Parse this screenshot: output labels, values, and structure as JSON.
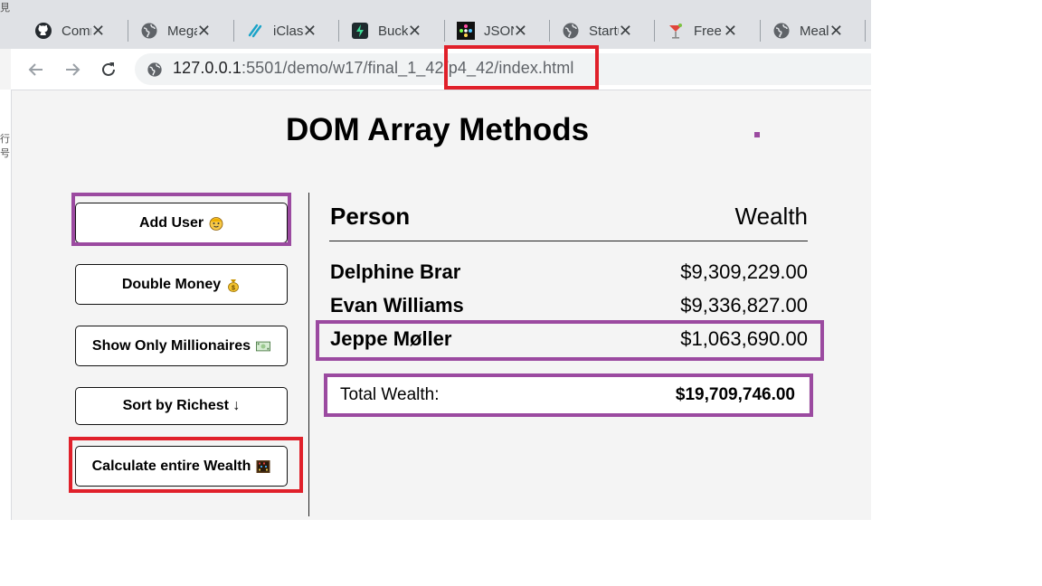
{
  "browser": {
    "left_sliver_text": "見",
    "tabs": [
      {
        "title": "Comm",
        "icon": "github-icon"
      },
      {
        "title": "Mega",
        "icon": "globe-icon"
      },
      {
        "title": "iClass",
        "icon": "iclass-icon"
      },
      {
        "title": "Buckets",
        "icon": "bucket-icon"
      },
      {
        "title": "JSON",
        "icon": "json-icon"
      },
      {
        "title": "Startup",
        "icon": "globe-icon"
      },
      {
        "title": "Free API",
        "icon": "cocktail-icon"
      },
      {
        "title": "Meal",
        "icon": "globe-icon"
      }
    ],
    "url_host": "127.0.0.1",
    "url_path": ":5501/demo/w17/final_1_42/p4_42/index.html",
    "left_strip_text": "行号",
    "colors": {
      "highlight_red": "#e0202a",
      "highlight_purple": "#9b4aa0"
    }
  },
  "page": {
    "title": "DOM Array Methods",
    "buttons": {
      "add_user": "Add User",
      "double_money": "Double Money",
      "show_millionaires": "Show Only Millionaires",
      "sort_richest": "Sort by Richest ↓",
      "calculate_wealth": "Calculate entire Wealth"
    },
    "table": {
      "header_person": "Person",
      "header_wealth": "Wealth",
      "rows": [
        {
          "name": "Delphine Brar",
          "wealth": "$9,309,229.00"
        },
        {
          "name": "Evan Williams",
          "wealth": "$9,336,827.00"
        },
        {
          "name": "Jeppe Møller",
          "wealth": "$1,063,690.00"
        }
      ],
      "total_label": "Total Wealth:",
      "total_value": "$19,709,746.00"
    }
  }
}
